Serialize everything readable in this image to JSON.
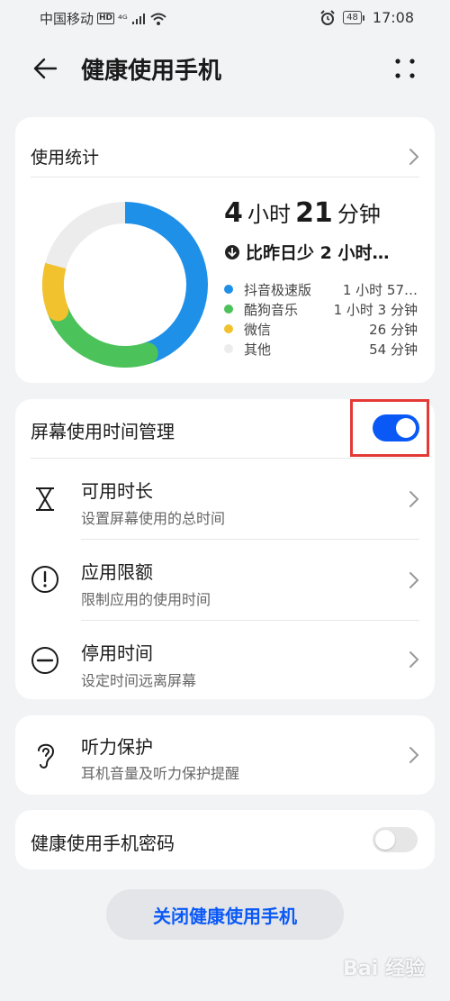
{
  "status_bar": {
    "carrier": "中国移动",
    "hd": "HD",
    "signal": "⁴ᴳ",
    "battery": "48",
    "time": "17:08"
  },
  "header": {
    "title": "健康使用手机"
  },
  "usage": {
    "title": "使用统计",
    "hours_num": "4",
    "hours_unit": "小时",
    "minutes_num": "21",
    "minutes_unit": "分钟",
    "compare_text": "比昨日少 2 小时…",
    "apps": [
      {
        "name": "抖音极速版",
        "value": "1 小时 57…",
        "color": "#1e90e8",
        "minutes": 117
      },
      {
        "name": "酷狗音乐",
        "value": "1 小时 3 分钟",
        "color": "#4cc25a",
        "minutes": 63
      },
      {
        "name": "微信",
        "value": "26 分钟",
        "color": "#f2c12e",
        "minutes": 26
      },
      {
        "name": "其他",
        "value": "54 分钟",
        "color": "#ececec",
        "minutes": 54
      }
    ]
  },
  "screen_time": {
    "title": "屏幕使用时间管理",
    "enabled": true,
    "items": [
      {
        "title": "可用时长",
        "subtitle": "设置屏幕使用的总时间",
        "icon": "hourglass-icon"
      },
      {
        "title": "应用限额",
        "subtitle": "限制应用的使用时间",
        "icon": "exclamation-circle-icon"
      },
      {
        "title": "停用时间",
        "subtitle": "设定时间远离屏幕",
        "icon": "minus-circle-icon"
      }
    ]
  },
  "hearing": {
    "title": "听力保护",
    "subtitle": "耳机音量及听力保护提醒",
    "icon": "ear-icon"
  },
  "password": {
    "title": "健康使用手机密码",
    "enabled": false
  },
  "close_button": {
    "label": "关闭健康使用手机"
  },
  "watermark": {
    "text": "Bai 经验"
  },
  "colors": {
    "accent": "#0a59f7",
    "highlight_box": "#e53935",
    "background": "#f1f3f5"
  }
}
